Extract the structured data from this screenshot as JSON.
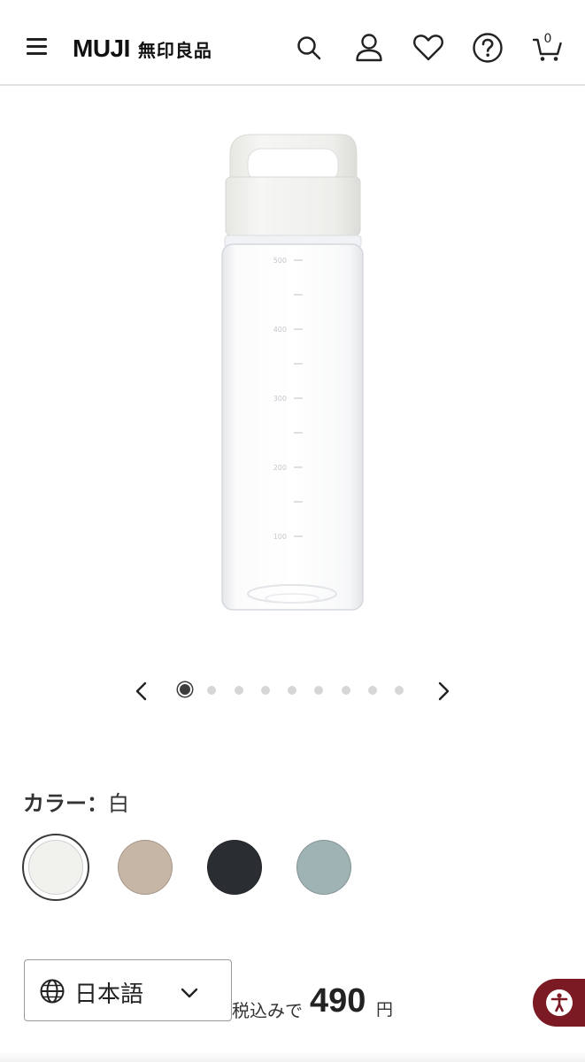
{
  "header": {
    "logo_latin": "MUJI",
    "logo_jp": "無印良品",
    "cart_count": "0"
  },
  "carousel": {
    "total_images": 9,
    "active_index": 1
  },
  "color": {
    "label": "カラー：",
    "selected": "白",
    "swatches": [
      {
        "color": "#f1f1ee"
      },
      {
        "color": "#c6b6a6"
      },
      {
        "color": "#2a2d31"
      },
      {
        "color": "#9fb3b4"
      }
    ]
  },
  "language": {
    "selected": "日本語"
  },
  "price": {
    "prefix": "税込みで",
    "value": "490",
    "unit": "円"
  },
  "bottle_scale": [
    "500",
    "400",
    "300",
    "200",
    "100"
  ],
  "colors": {
    "accent": "#7b1a22",
    "text": "#222222",
    "divider": "#e3e3e3"
  }
}
